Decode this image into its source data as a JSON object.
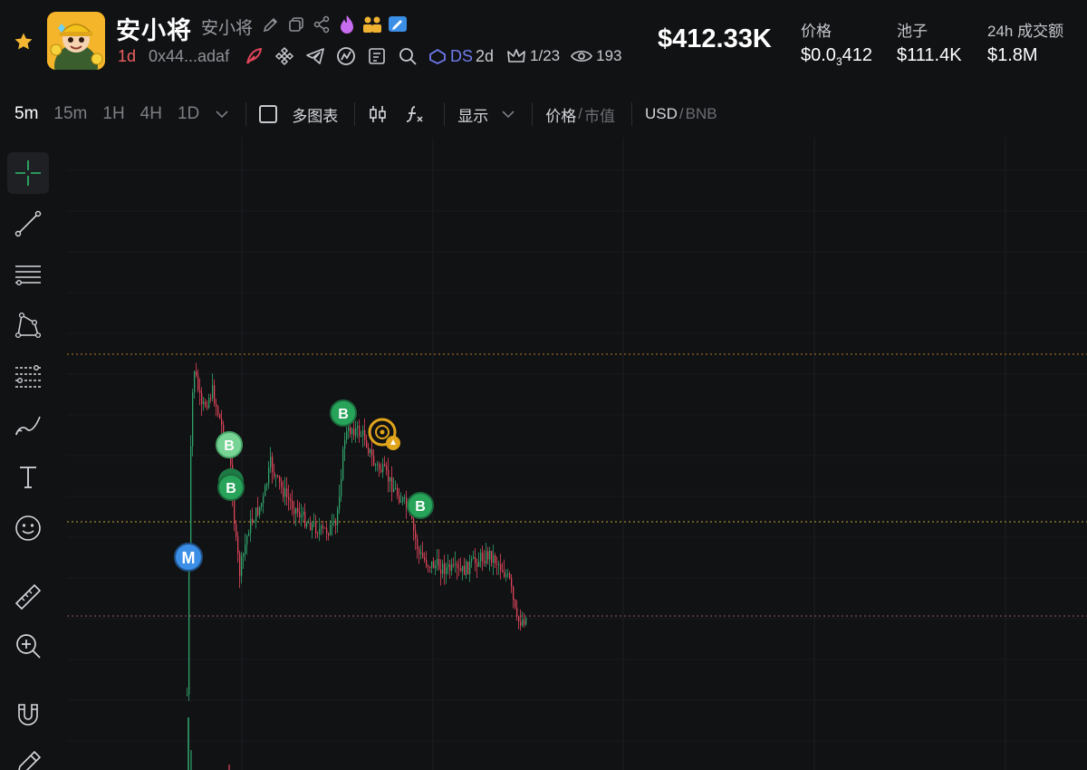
{
  "token": {
    "name": "安小将",
    "symbol": "安小将",
    "age": "1d",
    "address": "0x44...adaf",
    "ds_label": "DS",
    "ds_value": "2d",
    "holders_ratio": "1/23",
    "views": "193"
  },
  "stats": {
    "market_cap": "$412.33K",
    "price_label": "价格",
    "price_prefix": "$0.0",
    "price_sub": "3",
    "price_suffix": "412",
    "pool_label": "池子",
    "pool_value": "$111.4K",
    "volume_label": "24h 成交额",
    "volume_value": "$1.8M"
  },
  "toolbar": {
    "timeframes": [
      "5m",
      "15m",
      "1H",
      "4H",
      "1D"
    ],
    "active_timeframe": "5m",
    "multi_chart": "多图表",
    "display": "显示",
    "price": "价格",
    "slash": "/",
    "market_value": "市值",
    "usd": "USD",
    "bnb": "BNB"
  },
  "markers": {
    "m": "M",
    "b": "B"
  },
  "icons": {
    "favorite": "star-icon",
    "tools": [
      "crosshair-icon",
      "trend-line-icon",
      "horizontal-lines-icon",
      "pattern-icon",
      "fib-icon",
      "brush-icon",
      "text-icon",
      "emoji-icon",
      "ruler-icon",
      "zoom-in-icon",
      "magnet-icon",
      "pencil-icon"
    ]
  },
  "colors": {
    "up": "#2fa36b",
    "down": "#e0455a",
    "accent_orange": "#e39a2d",
    "marker_blue": "#3b8fe6",
    "marker_green": "#27a35a",
    "dev_marker": "#e0a51b"
  }
}
